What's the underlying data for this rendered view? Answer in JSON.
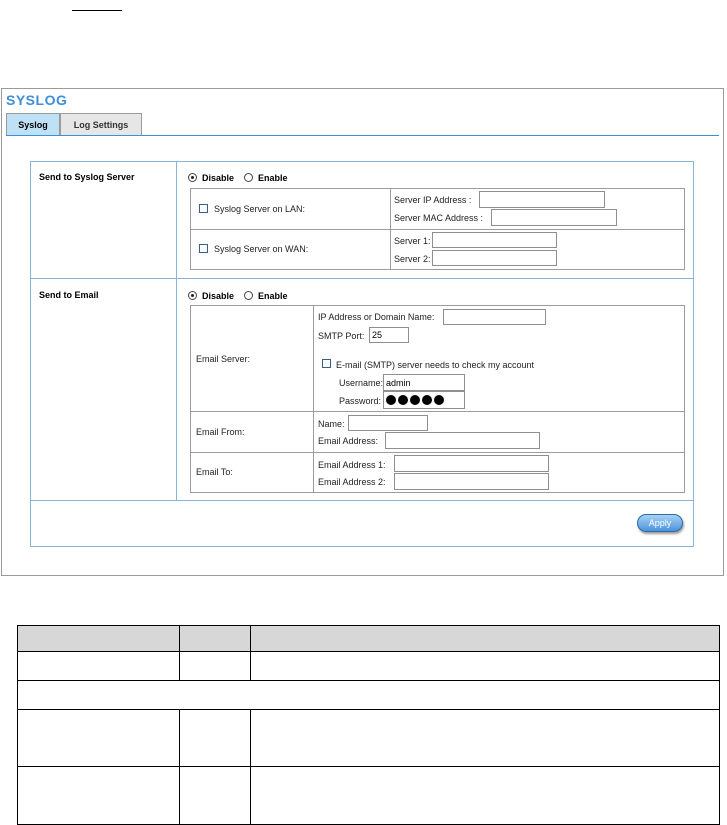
{
  "page_title": "SYSLOG",
  "tabs": [
    {
      "label": "Syslog",
      "active": true
    },
    {
      "label": "Log Settings",
      "active": false
    }
  ],
  "syslog": {
    "section_label": "Send to Syslog Server",
    "disable_label": "Disable",
    "enable_label": "Enable",
    "selected": "Disable",
    "lan": {
      "checkbox_label": "Syslog Server on LAN:",
      "ip_label": "Server IP Address :",
      "ip_value": "",
      "mac_label": "Server MAC Address :",
      "mac_value": ""
    },
    "wan": {
      "checkbox_label": "Syslog Server on WAN:",
      "server1_label": "Server 1:",
      "server1_value": "",
      "server2_label": "Server 2:",
      "server2_value": ""
    }
  },
  "email": {
    "section_label": "Send to Email",
    "disable_label": "Disable",
    "enable_label": "Enable",
    "selected": "Disable",
    "server": {
      "label": "Email Server:",
      "ip_domain_label": "IP Address or Domain Name:",
      "ip_domain_value": "",
      "smtp_port_label": "SMTP Port:",
      "smtp_port_value": "25",
      "auth_checkbox_label": "E-mail (SMTP) server needs to check my account",
      "username_label": "Username:",
      "username_value": "admin",
      "password_label": "Password:"
    },
    "from": {
      "label": "Email From:",
      "name_label": "Name:",
      "name_value": "",
      "address_label": "Email Address:",
      "address_value": ""
    },
    "to": {
      "label": "Email To:",
      "address1_label": "Email Address 1:",
      "address1_value": "",
      "address2_label": "Email Address 2:",
      "address2_value": ""
    }
  },
  "apply_label": "Apply",
  "colors": {
    "title": "#3e8ed8",
    "active_tab": "#bfe1f6",
    "frame_border": "#88b4d8",
    "table_header": "#d7d7d7"
  }
}
